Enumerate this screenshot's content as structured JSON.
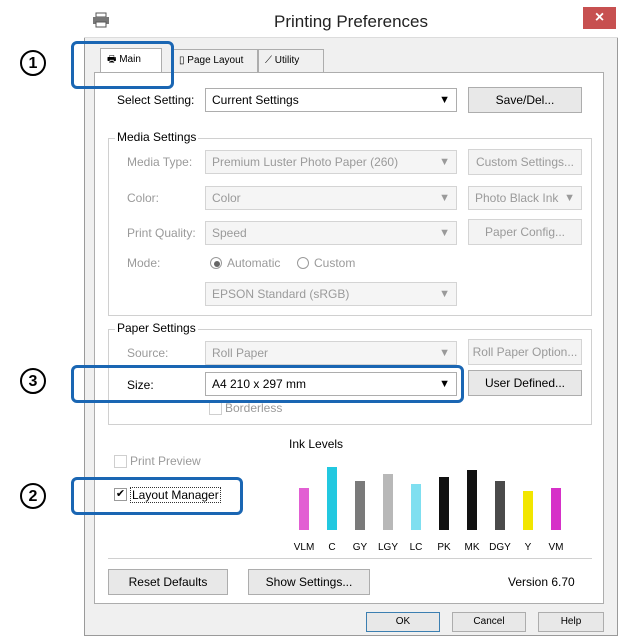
{
  "window": {
    "title": "Printing Preferences",
    "close_glyph": "×"
  },
  "tabs": [
    {
      "label": "Main",
      "icon": "printer-icon"
    },
    {
      "label": "Page Layout",
      "icon": "page-icon"
    },
    {
      "label": "Utility",
      "icon": "wrench-icon"
    }
  ],
  "select_setting": {
    "label": "Select Setting:",
    "value": "Current Settings",
    "button": "Save/Del..."
  },
  "media_settings": {
    "title": "Media Settings",
    "media_type_label": "Media Type:",
    "media_type_value": "Premium Luster Photo Paper (260)",
    "custom_settings_button": "Custom Settings...",
    "color_label": "Color:",
    "color_value": "Color",
    "ink_value": "Photo Black Ink",
    "print_quality_label": "Print Quality:",
    "print_quality_value": "Speed",
    "paper_config_button": "Paper Config...",
    "mode_label": "Mode:",
    "mode_automatic": "Automatic",
    "mode_custom": "Custom",
    "mode_value": "EPSON Standard (sRGB)"
  },
  "paper_settings": {
    "title": "Paper Settings",
    "source_label": "Source:",
    "source_value": "Roll Paper",
    "roll_option_button": "Roll Paper Option...",
    "size_label": "Size:",
    "size_value": "A4 210 x 297 mm",
    "user_defined_button": "User Defined...",
    "borderless_label": "Borderless"
  },
  "options": {
    "print_preview": "Print Preview",
    "layout_manager": "Layout Manager",
    "layout_manager_check": "✔"
  },
  "ink_levels": {
    "title": "Ink Levels",
    "inks": [
      {
        "name": "VLM",
        "color": "#e25fd3",
        "level": 0.6
      },
      {
        "name": "C",
        "color": "#22c8e0",
        "level": 0.9
      },
      {
        "name": "GY",
        "color": "#7a7a7a",
        "level": 0.7
      },
      {
        "name": "LGY",
        "color": "#b8b8b8",
        "level": 0.8
      },
      {
        "name": "LC",
        "color": "#7fdff0",
        "level": 0.65
      },
      {
        "name": "PK",
        "color": "#111111",
        "level": 0.75
      },
      {
        "name": "MK",
        "color": "#111111",
        "level": 0.85
      },
      {
        "name": "DGY",
        "color": "#4a4a4a",
        "level": 0.7
      },
      {
        "name": "Y",
        "color": "#f2e600",
        "level": 0.55
      },
      {
        "name": "VM",
        "color": "#d630c8",
        "level": 0.6
      }
    ]
  },
  "bottom": {
    "reset_defaults": "Reset Defaults",
    "show_settings": "Show Settings...",
    "version": "Version 6.70"
  },
  "dialog_buttons": {
    "ok": "OK",
    "cancel": "Cancel",
    "help": "Help"
  },
  "callouts": {
    "one": "1",
    "two": "2",
    "three": "3"
  },
  "accent_color": "#1a66b3"
}
